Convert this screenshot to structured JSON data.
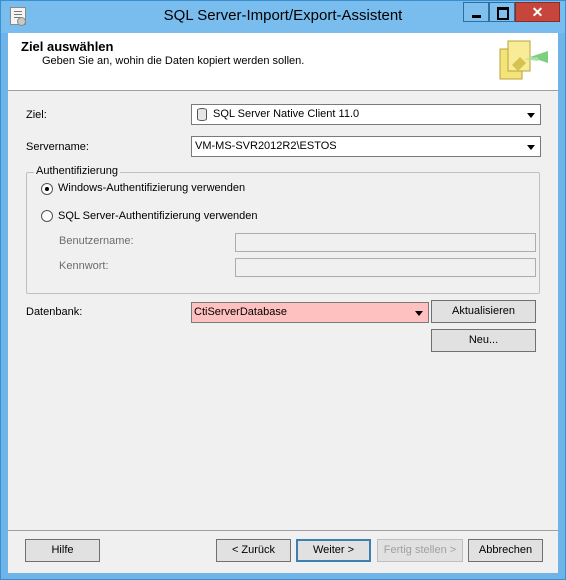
{
  "window": {
    "title": "SQL Server-Import/Export-Assistent",
    "close_glyph": "✕"
  },
  "header": {
    "title": "Ziel auswählen",
    "subtitle": "Geben Sie an, wohin die Daten kopiert werden sollen."
  },
  "form": {
    "ziel_label": "Ziel:",
    "ziel_value": "SQL Server Native Client 11.0",
    "servername_label": "Servername:",
    "servername_value": "VM-MS-SVR2012R2\\ESTOS",
    "auth_legend": "Authentifizierung",
    "windows_auth": "Windows-Authentifizierung verwenden",
    "sql_auth": "SQL Server-Authentifizierung verwenden",
    "username_label": "Benutzername:",
    "username_value": "",
    "password_label": "Kennwort:",
    "password_value": "",
    "database_label": "Datenbank:",
    "database_value": "CtiServerDatabase",
    "refresh_label": "Aktualisieren",
    "new_label": "Neu..."
  },
  "footer": {
    "help": "Hilfe",
    "back": "< Zurück",
    "next": "Weiter >",
    "finish": "Fertig stellen >",
    "cancel": "Abbrechen"
  },
  "colors": {
    "titlebar": "#79bdee",
    "close_button": "#c7463b",
    "database_highlight": "#ffc0c0",
    "dialog_bg": "#f0f0f0"
  },
  "icons": {
    "app": "document-icon",
    "wizard": "wizard-graphic-icon",
    "data_source": "database-icon"
  }
}
